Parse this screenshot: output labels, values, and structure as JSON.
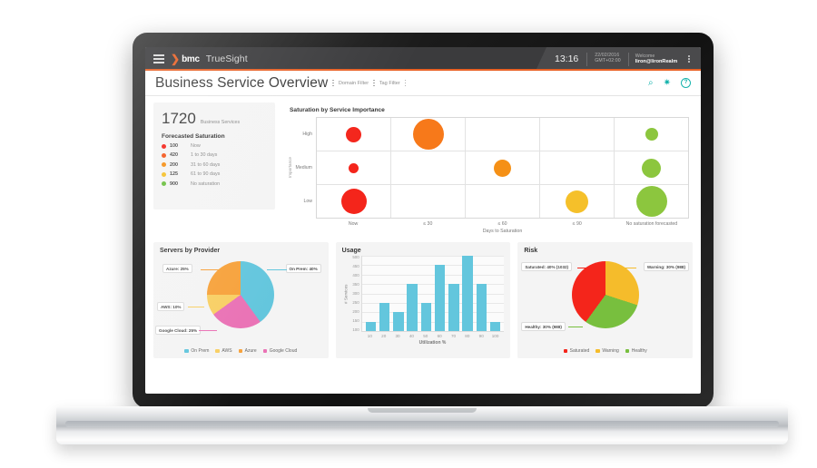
{
  "app": {
    "brand": "bmc",
    "product": "TrueSight",
    "brand_chevron": "❯",
    "clock": "13:16",
    "date": "22/02/2016",
    "timezone": "GMT+02:00",
    "welcome_label": "Welcome",
    "user": "liron@lironRealm",
    "accent_orange": "#e96125",
    "accent_teal": "#15b3ac"
  },
  "titlebar": {
    "title": "Business Service Overview",
    "domain_filter": "Domain Filter",
    "tag_filter": "Tag Filter",
    "search_icon": "⌕",
    "gear_icon": "✷",
    "help_icon": "?"
  },
  "kpi": {
    "value": "1720",
    "label": "Business Services",
    "heading": "Forecasted Saturation",
    "rows": [
      {
        "count": "100",
        "label": "Now",
        "color": "#f4251b"
      },
      {
        "count": "420",
        "label": "1 to 30 days",
        "color": "#f4561b"
      },
      {
        "count": "200",
        "label": "31 to 60 days",
        "color": "#f59016"
      },
      {
        "count": "125",
        "label": "61 to 90 days",
        "color": "#f5c02a"
      },
      {
        "count": "900",
        "label": "No saturation",
        "color": "#6bbf3f"
      }
    ]
  },
  "chart_data": [
    {
      "type": "scatter",
      "name": "saturation-by-service-importance",
      "title": "Saturation by Service Importance",
      "xlabel": "Days to Saturation",
      "ylabel": "Importance",
      "categories": [
        "Now",
        "≤ 30",
        "≤ 60",
        "≤ 90",
        "No saturation forecasted"
      ],
      "y_categories": [
        "High",
        "Medium",
        "Low"
      ],
      "grid": true,
      "points": [
        {
          "x": "Now",
          "y": "High",
          "size": 17,
          "color": "#f4251b"
        },
        {
          "x": "≤ 30",
          "y": "High",
          "size": 34,
          "color": "#f7791a"
        },
        {
          "x": "No saturation forecasted",
          "y": "High",
          "size": 14,
          "color": "#8cc63e"
        },
        {
          "x": "Now",
          "y": "Medium",
          "size": 11,
          "color": "#f4251b"
        },
        {
          "x": "≤ 60",
          "y": "Medium",
          "size": 19,
          "color": "#f59016"
        },
        {
          "x": "No saturation forecasted",
          "y": "Medium",
          "size": 21,
          "color": "#8cc63e"
        },
        {
          "x": "Now",
          "y": "Low",
          "size": 28,
          "color": "#f4251b"
        },
        {
          "x": "≤ 90",
          "y": "Low",
          "size": 25,
          "color": "#f5c02a"
        },
        {
          "x": "No saturation forecasted",
          "y": "Low",
          "size": 34,
          "color": "#8cc63e"
        }
      ]
    },
    {
      "type": "pie",
      "name": "servers-by-provider",
      "title": "Servers by Provider",
      "slices": [
        {
          "label": "On Prem",
          "value": 40,
          "callout": "On Prem: 40%",
          "color": "#63c6dd"
        },
        {
          "label": "Google Cloud",
          "value": 25,
          "callout": "Google Cloud: 25%",
          "color": "#ea72b5"
        },
        {
          "label": "AWS",
          "value": 10,
          "callout": "AWS: 10%",
          "color": "#f8cf64"
        },
        {
          "label": "Azure",
          "value": 25,
          "callout": "Azure: 25%",
          "color": "#f7a23c"
        }
      ],
      "legend": [
        "On Prem",
        "AWS",
        "Azure",
        "Google Cloud"
      ],
      "legend_position": "bottom"
    },
    {
      "type": "bar",
      "name": "usage",
      "title": "Usage",
      "xlabel": "Utilization %",
      "ylabel": "# Services",
      "categories": [
        "10",
        "20",
        "30",
        "40",
        "50",
        "60",
        "70",
        "80",
        "90",
        "100"
      ],
      "values": [
        150,
        250,
        200,
        350,
        250,
        450,
        350,
        500,
        350,
        150
      ],
      "yticks": [
        "500",
        "450",
        "400",
        "350",
        "300",
        "250",
        "200",
        "150",
        "100"
      ],
      "ylim": [
        100,
        500
      ],
      "bar_color": "#63c6dd",
      "grid": true
    },
    {
      "type": "pie",
      "name": "risk",
      "title": "Risk",
      "slices": [
        {
          "label": "Warning",
          "value": 30,
          "callout": "Warning: 30% (988)",
          "color": "#f5bc2b"
        },
        {
          "label": "Healthy",
          "value": 30,
          "callout": "Healthy: 30% (988)",
          "color": "#78bf3e"
        },
        {
          "label": "Saturated",
          "value": 40,
          "callout": "Saturated: 40% (1032)",
          "color": "#f4251b"
        }
      ],
      "legend": [
        "Saturated",
        "Warning",
        "Healthy"
      ],
      "legend_position": "bottom"
    }
  ]
}
